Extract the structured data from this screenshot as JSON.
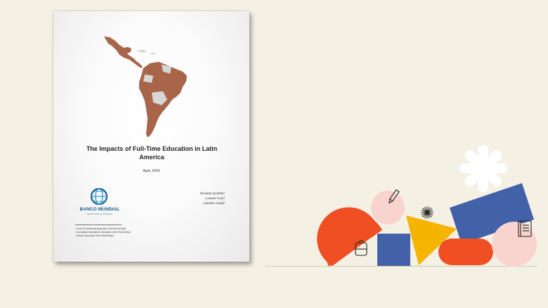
{
  "document": {
    "title": "The Impacts of Full-Time Education in Latin America",
    "date": "April, 2024",
    "publisher": {
      "name": "BANCO MUNDIAL",
      "sub": "GRUPO BANCO MUNDIAL"
    },
    "authors": [
      "Giovana Quintão¹",
      "Louisee Cruz²",
      "Leandro Costa³"
    ],
    "footnotes": [
      "¹ Junior Professional Associate of the World Bank",
      "² Consultant Specialist in Education of the World Bank",
      "³ Senior Economist of the World Bank"
    ]
  },
  "colors": {
    "map_highlight": "#a8654a",
    "map_other": "#d6d6d6",
    "shape_red": "#f04e23",
    "shape_blue": "#4361a9",
    "shape_yellow": "#f5b400",
    "shape_pink": "#f9d4cf",
    "shape_white": "#ffffff"
  },
  "decor_icons": [
    "pencil-icon",
    "backpack-icon",
    "notebook-icon",
    "burst-icon",
    "flower-shape"
  ]
}
